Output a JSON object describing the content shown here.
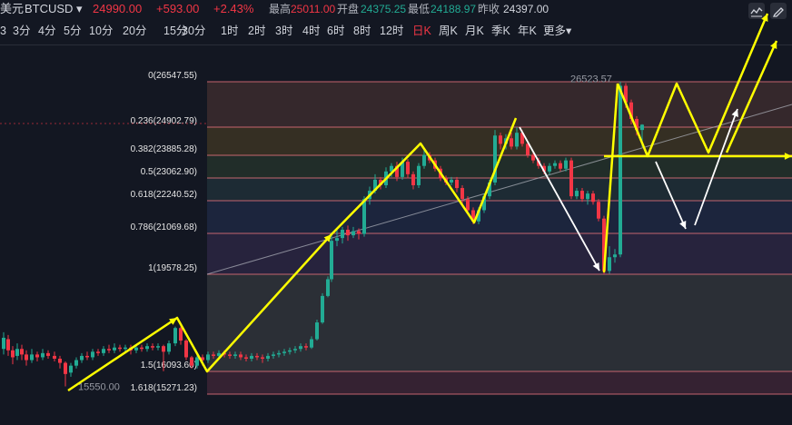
{
  "header": {
    "currency_fragment": "美元",
    "symbol": "BTCUSD",
    "dropdown": "▾",
    "price": "24990.00",
    "change": "+593.00",
    "change_pct": "+2.43%",
    "high_label": "最高",
    "high_value": "25011.00",
    "open_label": "开盘",
    "open_value": "24375.25",
    "low_label": "最低",
    "low_value": "24188.97",
    "prev_close_label": "昨收",
    "prev_close_value": "24397.00"
  },
  "toolbar": {
    "intervals": [
      "3",
      "3分",
      "4分",
      "5分",
      "10分",
      "20分",
      "15分",
      "30分",
      "1时",
      "2时",
      "3时",
      "4时",
      "6时",
      "8时",
      "12时",
      "日K",
      "周K",
      "月K",
      "季K",
      "年K",
      "更多▾"
    ],
    "active": "日K"
  },
  "tools": [
    {
      "name": "indicator-icon",
      "glyph": "≈"
    },
    {
      "name": "draw-pen-icon",
      "glyph": "✎"
    }
  ],
  "chart_data": {
    "type": "candlestick",
    "symbol": "BTCUSD",
    "fib_levels": [
      {
        "ratio": "0",
        "price": 26547.55,
        "label": "0(26547.55)"
      },
      {
        "ratio": "0.236",
        "price": 24902.79,
        "label": "0.236(24902.79)"
      },
      {
        "ratio": "0.382",
        "price": 23885.28,
        "label": "0.382(23885.28)"
      },
      {
        "ratio": "0.5",
        "price": 23062.9,
        "label": "0.5(23062.90)"
      },
      {
        "ratio": "0.618",
        "price": 22240.52,
        "label": "0.618(22240.52)"
      },
      {
        "ratio": "0.786",
        "price": 21069.68,
        "label": "0.786(21069.68)"
      },
      {
        "ratio": "1",
        "price": 19578.25,
        "label": "1(19578.25)"
      },
      {
        "ratio": "1.5",
        "price": 16093.6,
        "label": "1.5(16093.60)"
      },
      {
        "ratio": "1.618",
        "price": 15271.23,
        "label": "1.618(15271.23)"
      }
    ],
    "annotations": [
      {
        "text": "26523.57",
        "price": 26523.57
      },
      {
        "text": "15550.00",
        "price": 15550.0
      }
    ],
    "colors": {
      "up": "#22ab94",
      "down": "#f23645",
      "drawing": "#ffff00",
      "projection": "#ffffff"
    }
  }
}
